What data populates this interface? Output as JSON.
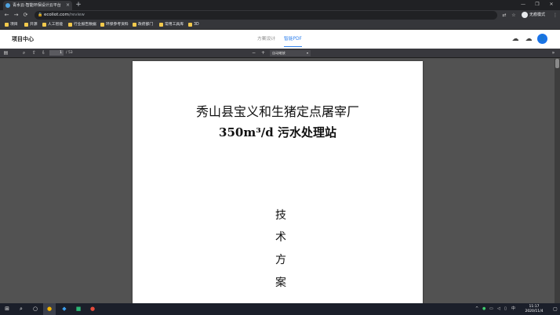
{
  "browser": {
    "tab_title": "青水云-智能环保设计云平台",
    "tab_close": "×",
    "new_tab": "+",
    "address_domain": "ecoliot.com",
    "address_path": "/review",
    "profile_label": "无痕模式",
    "window_controls": [
      "—",
      "❐",
      "✕"
    ]
  },
  "bookmarks": [
    "项目",
    "开源",
    "人工智能",
    "行业报告数据",
    "环保参考资料",
    "政府部门",
    "常用工具库",
    "3D"
  ],
  "app": {
    "title": "项目中心",
    "tabs": [
      {
        "label": "方案设计",
        "active": false
      },
      {
        "label": "智能PDF",
        "active": true
      }
    ],
    "user_icon": "user-icon"
  },
  "pdf_toolbar": {
    "current_page": "1",
    "page_count": "/ 53",
    "zoom_minus": "−",
    "zoom_plus": "+",
    "zoom_select": "自动缩放"
  },
  "document": {
    "title_line1": "秀山县宝义和生猪定点屠宰厂",
    "title_line2": "350m³/d 污水处理站",
    "vertical_chars": [
      "技",
      "术",
      "方",
      "案"
    ]
  },
  "taskbar": {
    "clock_time": "11:17",
    "clock_date": "2020/11/4",
    "ime": "中",
    "tray_caret": "^"
  },
  "colors": {
    "accent": "#2f80ed",
    "viewer_bg": "#525252",
    "taskbar_bg": "#1b1f2a"
  }
}
